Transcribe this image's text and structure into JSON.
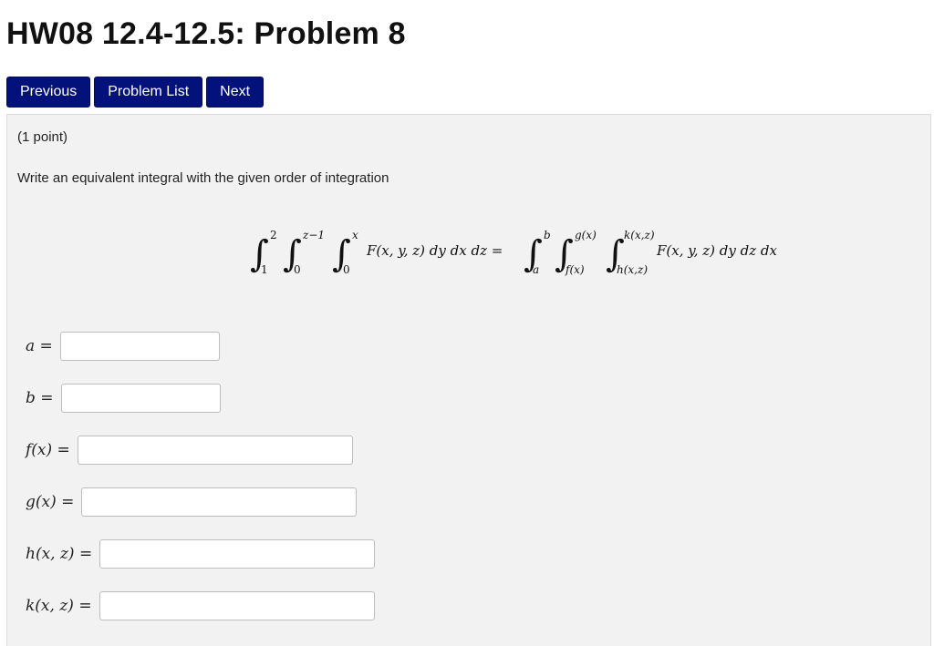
{
  "page": {
    "title": "HW08 12.4-12.5: Problem 8"
  },
  "nav": {
    "previous": "Previous",
    "problem_list": "Problem List",
    "next": "Next"
  },
  "problem": {
    "points": "(1 point)",
    "instruction": "Write an equivalent integral with the given order of integration",
    "equation": {
      "lhs": {
        "outer": {
          "lower": "1",
          "upper": "2"
        },
        "middle": {
          "lower": "0",
          "upper": "z−1"
        },
        "inner": {
          "lower": "0",
          "upper": "x"
        },
        "integrand": "F(x, y, z) dy dx dz ="
      },
      "rhs": {
        "outer": {
          "lower": "a",
          "upper": "b"
        },
        "middle": {
          "lower": "f(x)",
          "upper": "g(x)"
        },
        "inner": {
          "lower": "h(x,z)",
          "upper": "k(x,z)"
        },
        "integrand": "F(x, y, z) dy dz dx"
      }
    },
    "answers": [
      {
        "label": "a =",
        "value": ""
      },
      {
        "label": "b =",
        "value": ""
      },
      {
        "label": "f(x) =",
        "value": ""
      },
      {
        "label": "g(x) =",
        "value": ""
      },
      {
        "label": "h(x, z) =",
        "value": ""
      },
      {
        "label": "k(x, z) =",
        "value": ""
      }
    ]
  }
}
